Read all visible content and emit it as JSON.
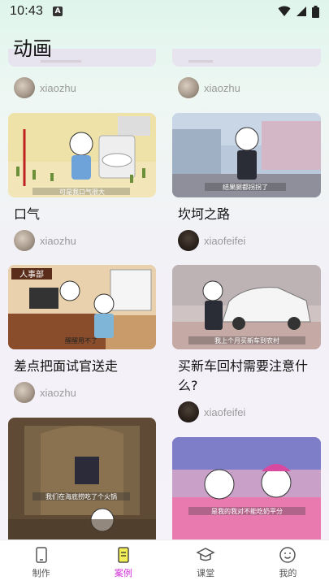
{
  "status": {
    "time": "10:43",
    "a_badge": "A"
  },
  "page": {
    "title": "动画"
  },
  "top_row": [
    {
      "author": "xiaozhu"
    },
    {
      "author": "xiaozhu"
    }
  ],
  "cards": [
    {
      "title": "口气",
      "author": "xiaozhu",
      "caption": "可是我口气很大"
    },
    {
      "title": "坎坷之路",
      "author": "xiaofeifei",
      "caption": "结果腿都拐拐了"
    },
    {
      "title": "差点把面试官送走",
      "author": "xiaozhu",
      "caption": "醒醒用不了",
      "sign": "人事部"
    },
    {
      "title": "买新车回村需要注意什么?",
      "author": "xiaofeifei",
      "caption": "我上个月买新车到农村"
    },
    {
      "title": "",
      "author": "",
      "caption": "我们在海底捞吃了个火锅"
    },
    {
      "title": "",
      "author": "",
      "caption": "是我的我对不能吃奶平分"
    }
  ],
  "tabs": [
    {
      "label": "制作",
      "icon": "phone-icon"
    },
    {
      "label": "案例",
      "icon": "document-icon",
      "active": true
    },
    {
      "label": "课堂",
      "icon": "graduation-cap-icon"
    },
    {
      "label": "我的",
      "icon": "smiley-icon"
    }
  ],
  "colors": {
    "accent": "#d12bd6",
    "tab_active_icon_bg": "#f1ef55"
  }
}
